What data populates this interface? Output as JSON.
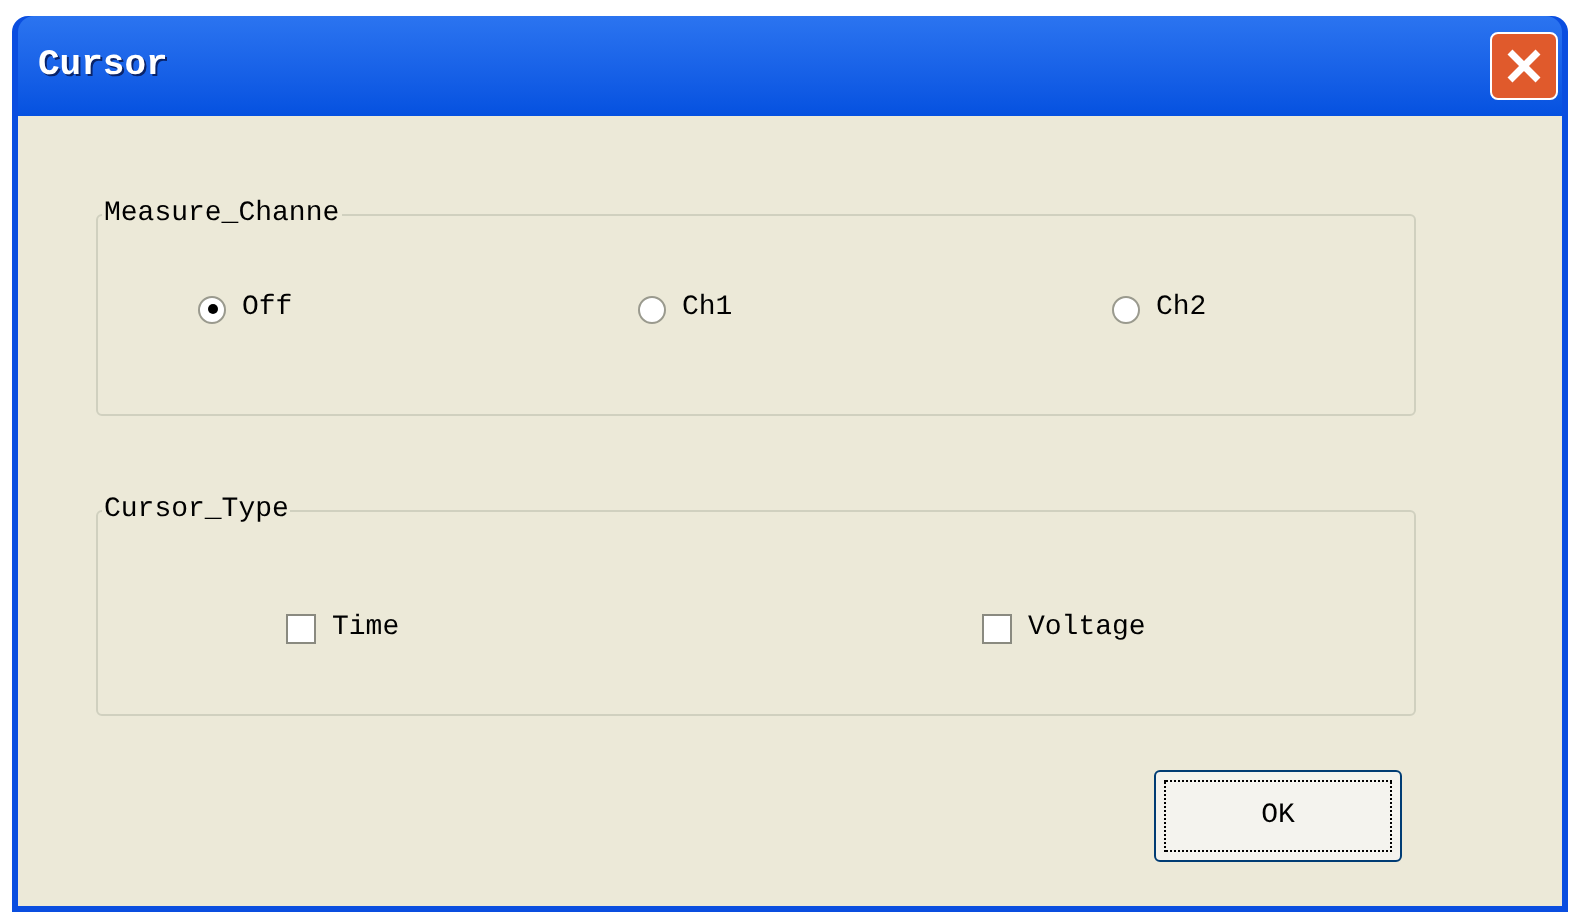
{
  "window": {
    "title": "Cursor"
  },
  "measure_channel": {
    "legend": "Measure_Channe",
    "options": [
      {
        "label": "Off",
        "selected": true
      },
      {
        "label": "Ch1",
        "selected": false
      },
      {
        "label": "Ch2",
        "selected": false
      }
    ]
  },
  "cursor_type": {
    "legend": "Cursor_Type",
    "options": [
      {
        "label": "Time",
        "checked": false
      },
      {
        "label": "Voltage",
        "checked": false
      }
    ]
  },
  "buttons": [
    {
      "label": "OK"
    }
  ]
}
